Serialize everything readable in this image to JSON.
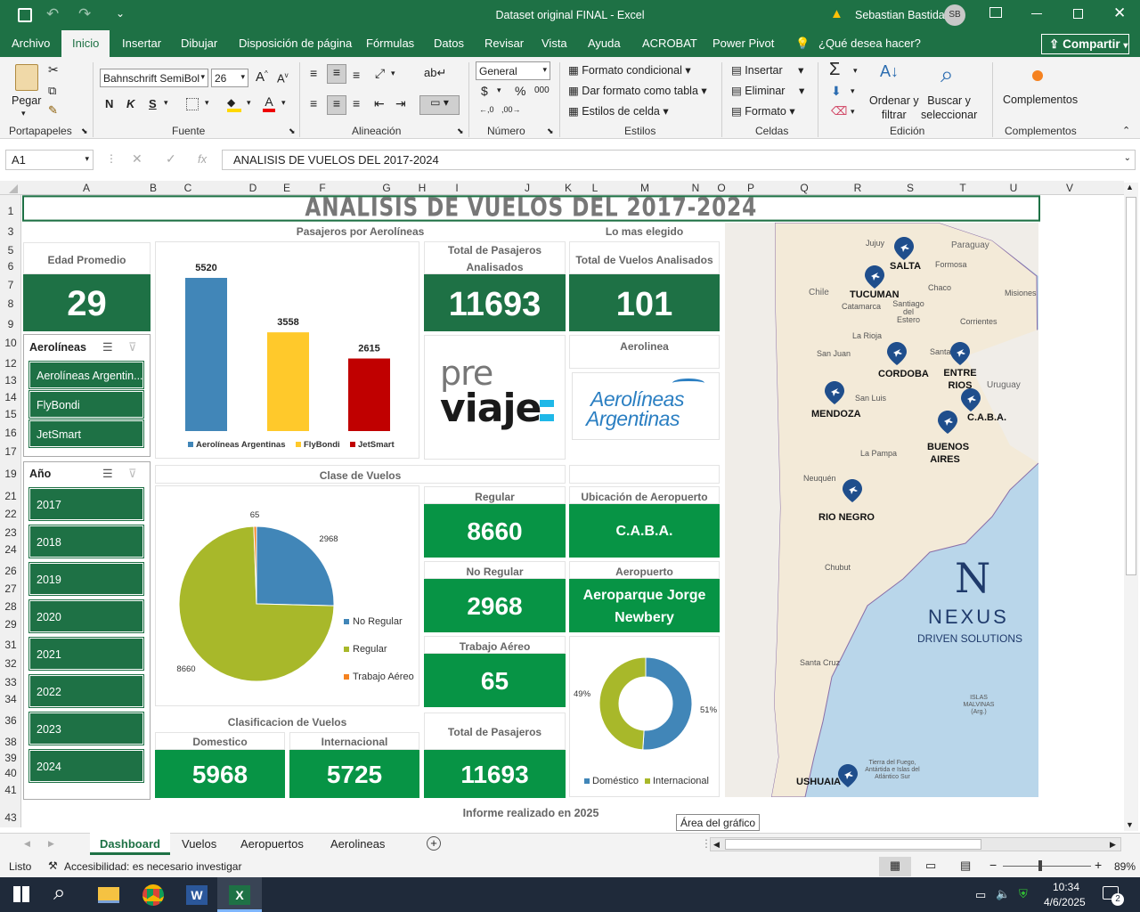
{
  "window": {
    "title": "Dataset original FINAL  -  Excel",
    "user": "Sebastian Bastida",
    "user_initials": "SB"
  },
  "menu": {
    "tabs": [
      "Archivo",
      "Inicio",
      "Insertar",
      "Dibujar",
      "Disposición de página",
      "Fórmulas",
      "Datos",
      "Revisar",
      "Vista",
      "Ayuda",
      "ACROBAT",
      "Power Pivot"
    ],
    "tell_me": "¿Qué desea hacer?",
    "share": "Compartir"
  },
  "ribbon": {
    "clipboard": {
      "paste": "Pegar",
      "label": "Portapapeles"
    },
    "font": {
      "name": "Bahnschrift SemiBol",
      "size": "26",
      "label": "Fuente",
      "bold": "N",
      "italic": "K",
      "underline": "S"
    },
    "alignment": {
      "label": "Alineación"
    },
    "number": {
      "format": "General",
      "label": "Número",
      "currency": "$",
      "percent": "%",
      "thousands": "000"
    },
    "styles": {
      "conditional": "Formato condicional",
      "table": "Dar formato como tabla",
      "cell": "Estilos de celda",
      "label": "Estilos"
    },
    "cells": {
      "insert": "Insertar",
      "delete": "Eliminar",
      "format": "Formato",
      "label": "Celdas"
    },
    "editing": {
      "sort": "Ordenar y\nfiltrar",
      "find": "Buscar y\nseleccionar",
      "label": "Edición"
    },
    "addins": {
      "btn": "Complementos",
      "label": "Complementos"
    }
  },
  "formula_bar": {
    "name_box": "A1",
    "fx": "fx",
    "content": "ANALISIS DE VUELOS DEL 2017-2024"
  },
  "columns": [
    "A",
    "B",
    "C",
    "D",
    "E",
    "F",
    "G",
    "H",
    "I",
    "J",
    "K",
    "L",
    "M",
    "N",
    "O",
    "P",
    "Q",
    "R",
    "S",
    "T",
    "U",
    "V"
  ],
  "rows": [
    "1",
    "3",
    "5",
    "6",
    "7",
    "8",
    "9",
    "10",
    "12",
    "13",
    "14",
    "15",
    "16",
    "17",
    "19",
    "21",
    "22",
    "23",
    "24",
    "26",
    "27",
    "28",
    "29",
    "31",
    "32",
    "33",
    "34",
    "36",
    "38",
    "39",
    "40",
    "41",
    "43"
  ],
  "dashboard": {
    "title": "ANALISIS DE VUELOS DEL 2017-2024",
    "edad_label": "Edad Promedio",
    "edad_value": "29",
    "aerolineas_slicer": {
      "title": "Aerolíneas",
      "items": [
        "Aerolíneas Argentin...",
        "FlyBondi",
        "JetSmart"
      ]
    },
    "anio_slicer": {
      "title": "Año",
      "items": [
        "2017",
        "2018",
        "2019",
        "2020",
        "2021",
        "2022",
        "2023",
        "2024"
      ]
    },
    "pasajeros_title": "Pasajeros por Aerolíneas",
    "total_pax_label": "Total de Pasajeros Analisados",
    "total_pax_value": "11693",
    "mas_elegido_label": "Lo mas elegido",
    "total_vuelos_label": "Total de Vuelos Analisados",
    "total_vuelos_value": "101",
    "aerolinea_label": "Aerolinea",
    "previaje_logo": {
      "line1": "pre",
      "line2": "viaje"
    },
    "aerolineas_logo": {
      "line1": "Aerolíneas",
      "line2": "Argentinas"
    },
    "clase_title": "Clase de Vuelos",
    "regular_label": "Regular",
    "regular_value": "8660",
    "no_regular_label": "No Regular",
    "no_regular_value": "2968",
    "trabajo_label": "Trabajo Aéreo",
    "trabajo_value": "65",
    "ubicacion_label": "Ubicación de Aeropuerto",
    "ubicacion_value": "C.A.B.A.",
    "aeropuerto_label": "Aeropuerto",
    "aeropuerto_value": "Aeroparque Jorge Newbery",
    "clasif_title": "Clasificacion de Vuelos",
    "domestico_label": "Domestico",
    "domestico_value": "5968",
    "internacional_label": "Internacional",
    "internacional_value": "5725",
    "total_pasajeros_label": "Total de Pasajeros",
    "total_pasajeros_value": "11693",
    "footer": "Informe realizado en 2025",
    "tooltip": "Área del gráfico"
  },
  "chart_data": [
    {
      "type": "bar",
      "categories": [
        "Aerolíneas Argentinas",
        "FlyBondi",
        "JetSmart"
      ],
      "values": [
        5520,
        3558,
        2615
      ],
      "colors": [
        "#4186b8",
        "#ffc92b",
        "#c00000"
      ],
      "title": "Pasajeros por Aerolíneas"
    },
    {
      "type": "pie",
      "categories": [
        "No Regular",
        "Regular",
        "Trabajo Aéreo"
      ],
      "values": [
        2968,
        8660,
        65
      ],
      "colors": [
        "#4186b8",
        "#a8b82a",
        "#f58220"
      ],
      "title": "Clase de Vuelos"
    },
    {
      "type": "pie",
      "categories": [
        "Doméstico",
        "Internacional"
      ],
      "values": [
        51,
        49
      ],
      "labels": [
        "51%",
        "49%"
      ],
      "colors": [
        "#4186b8",
        "#a8b82a"
      ]
    }
  ],
  "map": {
    "labels": [
      "SALTA",
      "TUCUMAN",
      "CORDOBA",
      "ENTRE RIOS",
      "MENDOZA",
      "C.A.B.A.",
      "BUENOS AIRES",
      "RIO NEGRO",
      "USHUAIA"
    ],
    "regions": [
      "Jujuy",
      "Paraguay",
      "Formosa",
      "Chile",
      "Chaco",
      "Misiones",
      "Catamarca",
      "Santiago del Estero",
      "Corrientes",
      "La Rioja",
      "San Juan",
      "Santa Fe",
      "San Luis",
      "Uruguay",
      "La Pampa",
      "Neuquén",
      "Chubut",
      "Santa Cruz",
      "ISLAS MALVINAS (Arg.)",
      "Tierra del Fuego, Antártida e Islas del Atlántico Sur"
    ],
    "brand": {
      "name": "NEXUS",
      "tagline": "DRIVEN SOLUTIONS"
    }
  },
  "sheets": {
    "tabs": [
      "Dashboard",
      "Vuelos",
      "Aeropuertos",
      "Aerolineas"
    ],
    "active": "Dashboard"
  },
  "status": {
    "ready": "Listo",
    "accessibility": "Accesibilidad: es necesario investigar",
    "zoom": "89%"
  },
  "taskbar": {
    "time": "10:34",
    "date": "4/6/2025",
    "notif": "2"
  }
}
